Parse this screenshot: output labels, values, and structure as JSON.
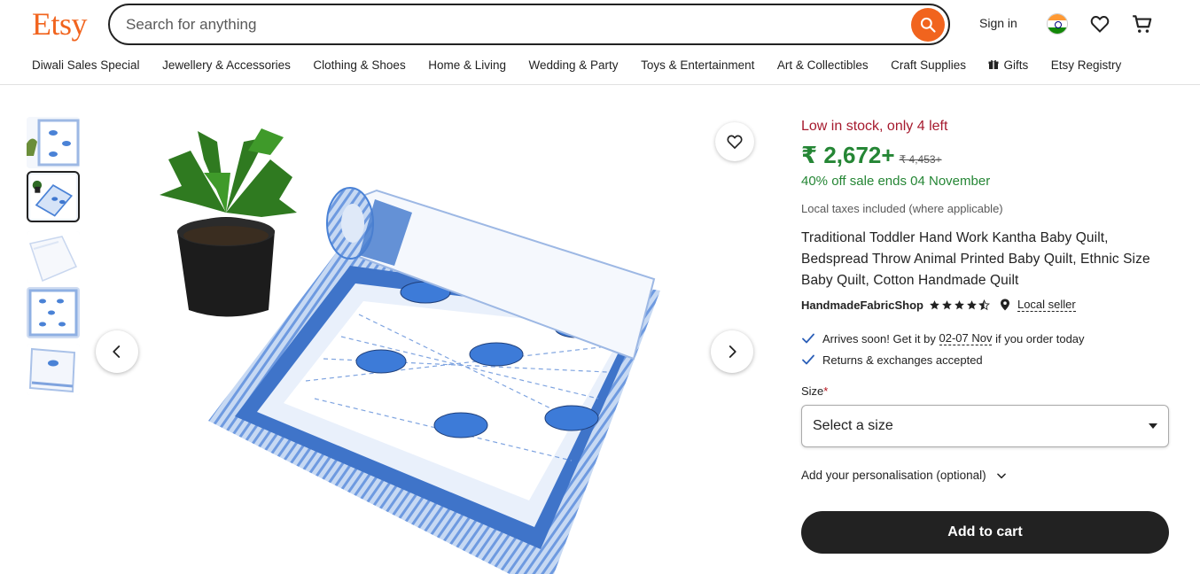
{
  "header": {
    "logo": "Etsy",
    "search_placeholder": "Search for anything",
    "signin_label": "Sign in",
    "brand_color": "#f1641e"
  },
  "categories": [
    "Diwali Sales Special",
    "Jewellery & Accessories",
    "Clothing & Shoes",
    "Home & Living",
    "Wedding & Party",
    "Toys & Entertainment",
    "Art & Collectibles",
    "Craft Supplies",
    "Gifts",
    "Etsy Registry"
  ],
  "gallery": {
    "selected_thumbnail": 2,
    "thumbnail_count": 5
  },
  "product": {
    "stock_notice": "Low in stock, only 4 left",
    "price": "₹ 2,672+",
    "original_price": "₹ 4,453+",
    "sale_notice": "40% off sale ends 04 November",
    "taxes_note": "Local taxes included (where applicable)",
    "title": "Traditional Toddler Hand Work Kantha Baby Quilt, Bedspread Throw Animal Printed Baby Quilt, Ethnic Size Baby Quilt, Cotton Handmade Quilt",
    "shop_name": "HandmadeFabricShop",
    "rating": 4.5,
    "local_seller_label": "Local seller",
    "arrival_prefix": "Arrives soon! Get it by ",
    "arrival_dates": "02-07 Nov",
    "arrival_suffix": " if you order today",
    "returns": "Returns & exchanges accepted",
    "size_label": "Size",
    "size_required_mark": "*",
    "size_select_value": "Select a size",
    "personalisation_label": "Add your personalisation (optional)",
    "add_to_cart_label": "Add to cart"
  },
  "colors": {
    "stock_red": "#a61a2e",
    "sale_green": "#258635",
    "button_dark": "#222222"
  }
}
